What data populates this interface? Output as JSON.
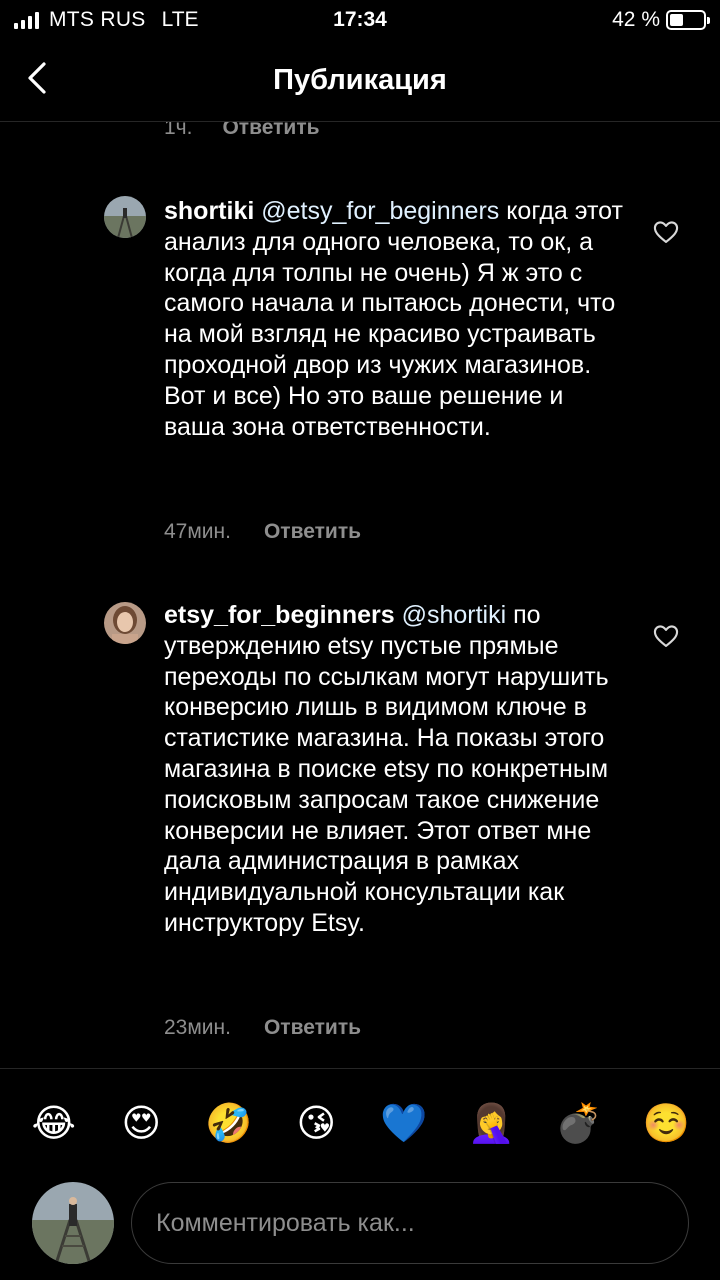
{
  "status_bar": {
    "carrier": "MTS RUS",
    "network": "LTE",
    "time": "17:34",
    "battery_label": "42 %",
    "battery_level": 0.42
  },
  "nav": {
    "title": "Публикация"
  },
  "previous_comment": {
    "time": "1ч.",
    "reply_label": "Ответить"
  },
  "comments": [
    {
      "username": "shortiki",
      "mention": "@etsy_for_beginners",
      "text": "когда этот анализ для одного человека, то ок, а когда для толпы не очень) Я ж это с самого начала и пытаюсь донести, что на мой взгляд не красиво устраивать проходной двор из чужих магазинов. Вот и все) Но это ваше решение и ваша зона ответственности.",
      "time": "47мин.",
      "reply_label": "Ответить"
    },
    {
      "username": "etsy_for_beginners",
      "mention": "@shortiki",
      "text": "по утверждению etsy пустые прямые переходы по ссылкам могут нарушить конверсию лишь в видимом ключе в статистике магазина. На показы этого магазина в поиске etsy по конкретным поисковым запросам такое снижение конверсии не влияет. Этот ответ мне дала администрация в рамках индивидуальной консультации как инструктору Etsy.",
      "time": "23мин.",
      "reply_label": "Ответить"
    }
  ],
  "emoji_bar": [
    "😂",
    "😍",
    "🤣",
    "😘",
    "💙",
    "🤦‍♀️",
    "💣",
    "☺️"
  ],
  "composer": {
    "placeholder": "Комментировать как..."
  },
  "colors": {
    "background": "#000000",
    "secondary_text": "#8e8e8e",
    "divider": "#262626"
  }
}
